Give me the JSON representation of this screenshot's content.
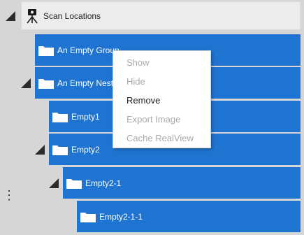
{
  "tree": {
    "root": {
      "label": "Scan Locations",
      "icon": "scanner-tripod-icon"
    },
    "nodes": [
      {
        "label": "An Empty Group",
        "icon": "folder-icon"
      },
      {
        "label": "An Empty Nest",
        "icon": "folder-icon"
      },
      {
        "label": "Empty1",
        "icon": "folder-icon"
      },
      {
        "label": "Empty2",
        "icon": "folder-icon"
      },
      {
        "label": "Empty2-1",
        "icon": "folder-icon"
      },
      {
        "label": "Empty2-1-1",
        "icon": "folder-icon"
      }
    ]
  },
  "context_menu": {
    "items": [
      {
        "label": "Show",
        "enabled": false
      },
      {
        "label": "Hide",
        "enabled": false
      },
      {
        "label": "Remove",
        "enabled": true
      },
      {
        "label": "Export Image",
        "enabled": false
      },
      {
        "label": "Cache RealView",
        "enabled": false
      }
    ]
  },
  "colors": {
    "node_background": "#1f74d1",
    "root_background": "#ececec",
    "panel_background": "#d6d6d6",
    "menu_disabled_text": "#a9a9a9",
    "menu_enabled_text": "#222222"
  }
}
